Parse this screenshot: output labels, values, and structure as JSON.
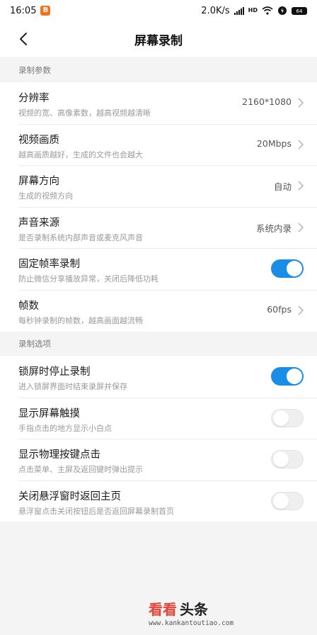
{
  "status_bar": {
    "time": "16:05",
    "notif_glyph": "B",
    "net_speed": "2.0K/s",
    "battery": "64",
    "icons": [
      "signal-icon",
      "hd-signal-icon",
      "wifi-icon",
      "alarm-icon",
      "battery-icon"
    ]
  },
  "header": {
    "title": "屏幕录制",
    "back_icon": "chevron-left-icon"
  },
  "section1": {
    "label": "录制参数",
    "rows": [
      {
        "title": "分辨率",
        "sub": "视频的宽、高像素数，越高视频越清晰",
        "value": "2160*1080"
      },
      {
        "title": "视频画质",
        "sub": "越高画质越好，生成的文件也会越大",
        "value": "20Mbps"
      },
      {
        "title": "屏幕方向",
        "sub": "生成的视频方向",
        "value": "自动"
      },
      {
        "title": "声音来源",
        "sub": "是否录制系统内部声音或麦克风声音",
        "value": "系统内录"
      },
      {
        "title": "固定帧率录制",
        "sub": "防止微信分享播放异常，关闭后降低功耗",
        "toggle": true
      },
      {
        "title": "帧数",
        "sub": "每秒钟录制的帧数，越高画面越流畅",
        "value": "60fps"
      }
    ]
  },
  "section2": {
    "label": "录制选项",
    "rows": [
      {
        "title": "锁屏时停止录制",
        "sub": "进入锁屏界面时结束录屏并保存",
        "toggle": true
      },
      {
        "title": "显示屏幕触摸",
        "sub": "手指点击的地方显示小白点",
        "toggle": false
      },
      {
        "title": "显示物理按键点击",
        "sub": "点击菜单、主屏及返回键时弹出提示",
        "toggle": false
      },
      {
        "title": "关闭悬浮窗时返回主页",
        "sub": "悬浮窗点击关闭按钮后是否返回屏幕录制首页",
        "toggle": false
      }
    ]
  },
  "watermark": {
    "part1": "看看",
    "part2": "头条",
    "url": "www.kankantoutiao.com"
  },
  "colors": {
    "accent": "#1a8ee6",
    "background": "#f4f4f4",
    "card": "#ffffff",
    "subtext": "#9a9a9a"
  }
}
